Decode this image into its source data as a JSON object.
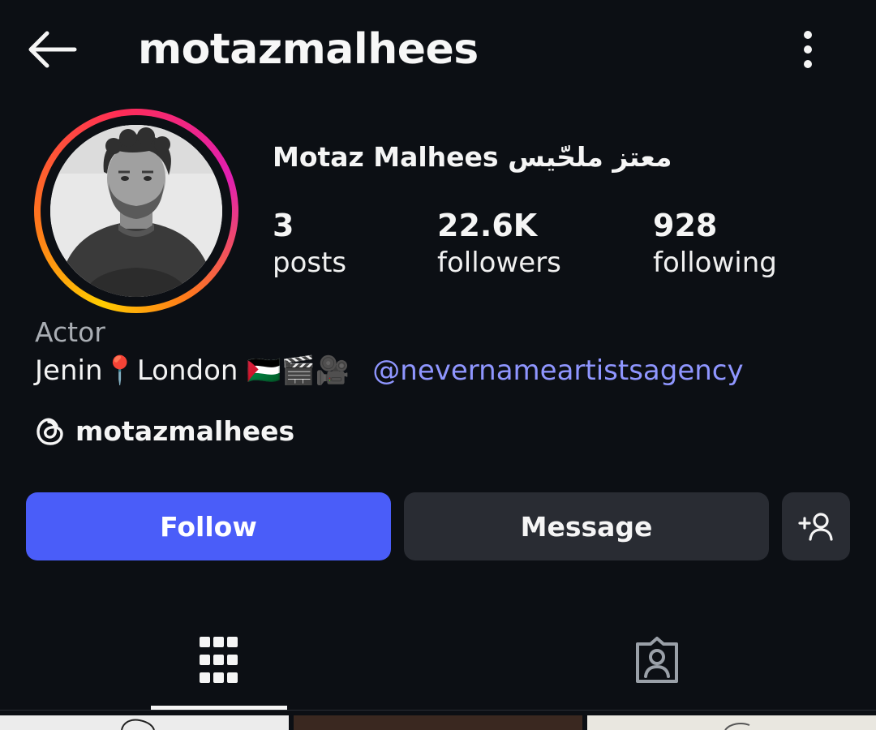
{
  "header": {
    "username": "motazmalhees",
    "back_icon": "arrow-left-icon",
    "more_icon": "more-vertical-icon"
  },
  "profile": {
    "full_name": "Motaz Malhees معتز ملحّيس",
    "avatar_icon": "profile-photo",
    "ring_colors": [
      "#ffcc00",
      "#ff7a1a",
      "#ff2d55",
      "#e11fb2"
    ],
    "stats": [
      {
        "value": "3",
        "label": "posts"
      },
      {
        "value": "22.6K",
        "label": "followers"
      },
      {
        "value": "928",
        "label": "following"
      }
    ]
  },
  "bio": {
    "category": "Actor",
    "text": "Jenin📍London 🇵🇸🎬🎥",
    "mention": "@nevernameartistsagency",
    "threads_icon": "threads-icon",
    "threads_username": "motazmalhees"
  },
  "actions": {
    "follow_label": "Follow",
    "message_label": "Message",
    "suggest_icon": "add-person-icon"
  },
  "tabs": [
    {
      "icon": "grid-icon",
      "active": true
    },
    {
      "icon": "tagged-user-icon",
      "active": false
    }
  ],
  "colors": {
    "background": "#0c0f14",
    "follow_button": "#4a5df9",
    "secondary_button": "#292c33",
    "link": "#8f96ff",
    "muted_text": "#a9adb3"
  }
}
